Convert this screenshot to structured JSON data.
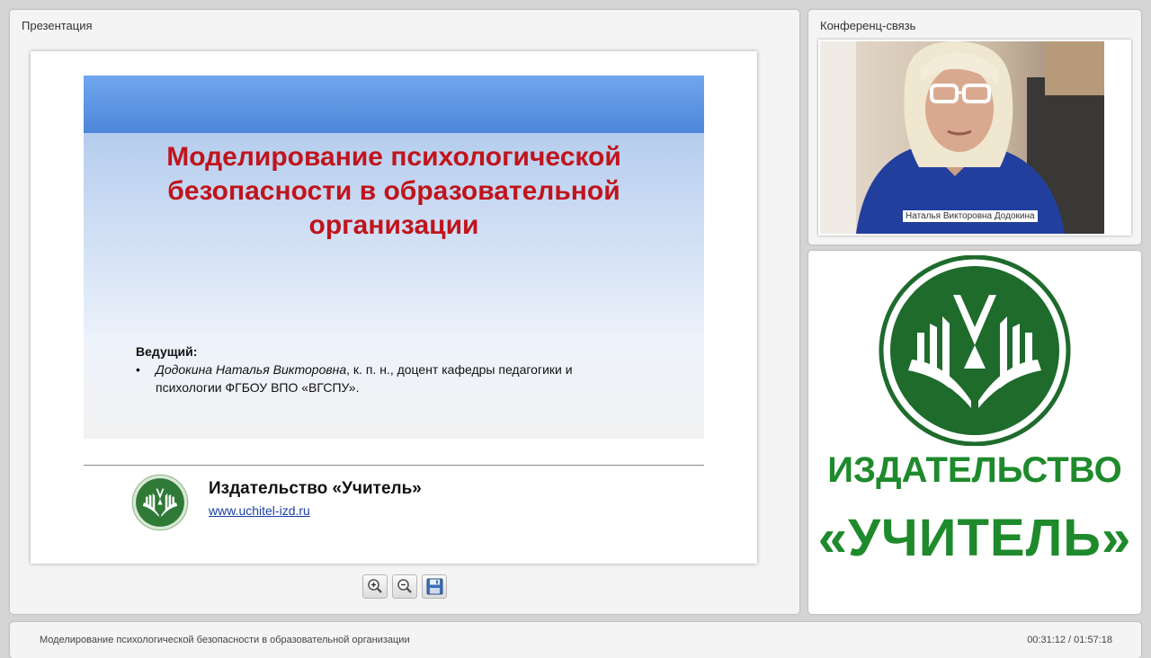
{
  "presentation_panel": {
    "title": "Презентация",
    "slide": {
      "title_lines": [
        "Моделирование психологической",
        "безопасности в образовательной",
        "организации"
      ],
      "presenter_label": "Ведущий:",
      "presenter_bullet": "•",
      "presenter_name": "Додокина Наталья Викторовна",
      "presenter_details_1": ", к. п. н., доцент кафедры педагогики и",
      "presenter_details_2": "психологии ФГБОУ ВПО «ВГСПУ».",
      "publisher_name": "Издательство «Учитель»",
      "publisher_url": "www.uchitel-izd.ru"
    },
    "toolbar": {
      "zoom_in_icon": "zoom-in-icon",
      "zoom_out_icon": "zoom-out-icon",
      "save_icon": "floppy-disk-icon"
    }
  },
  "conference_panel": {
    "title": "Конференц-связь",
    "participant_name": "Наталья Викторовна Додокина"
  },
  "brand_panel": {
    "line1": "ИЗДАТЕЛЬСТВО",
    "line2": "«УЧИТЕЛЬ»",
    "logo_color": "#1e6b2c"
  },
  "bottom_bar": {
    "title": "Моделирование психологической безопасности в образовательной организации",
    "time": "00:31:12 / 01:57:18"
  },
  "colors": {
    "slide_title": "#c0141c",
    "slide_header": "#4f86d4",
    "brand_green": "#1e8a2c"
  }
}
